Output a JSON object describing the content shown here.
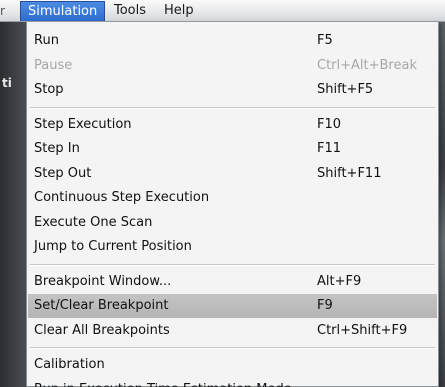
{
  "menubar": {
    "items": [
      {
        "label": "Simulation"
      },
      {
        "label": "Tools"
      },
      {
        "label": "Help"
      }
    ],
    "edge_glyph": "r"
  },
  "side_label": "ti",
  "menu": {
    "groups": [
      [
        {
          "label": "Run",
          "shortcut": "F5"
        },
        {
          "label": "Pause",
          "shortcut": "Ctrl+Alt+Break",
          "disabled": true
        },
        {
          "label": "Stop",
          "shortcut": "Shift+F5"
        }
      ],
      [
        {
          "label": "Step Execution",
          "shortcut": "F10"
        },
        {
          "label": "Step In",
          "shortcut": "F11"
        },
        {
          "label": "Step Out",
          "shortcut": "Shift+F11"
        },
        {
          "label": "Continuous Step Execution",
          "shortcut": ""
        },
        {
          "label": "Execute One Scan",
          "shortcut": ""
        },
        {
          "label": "Jump to Current Position",
          "shortcut": ""
        }
      ],
      [
        {
          "label": "Breakpoint Window...",
          "shortcut": "Alt+F9"
        },
        {
          "label": "Set/Clear Breakpoint",
          "shortcut": "F9",
          "highlighted": true
        },
        {
          "label": "Clear All Breakpoints",
          "shortcut": "Ctrl+Shift+F9"
        }
      ],
      [
        {
          "label": "Calibration",
          "shortcut": ""
        },
        {
          "label": "Run in Execution Time Estimation Mode",
          "shortcut": ""
        }
      ]
    ]
  }
}
